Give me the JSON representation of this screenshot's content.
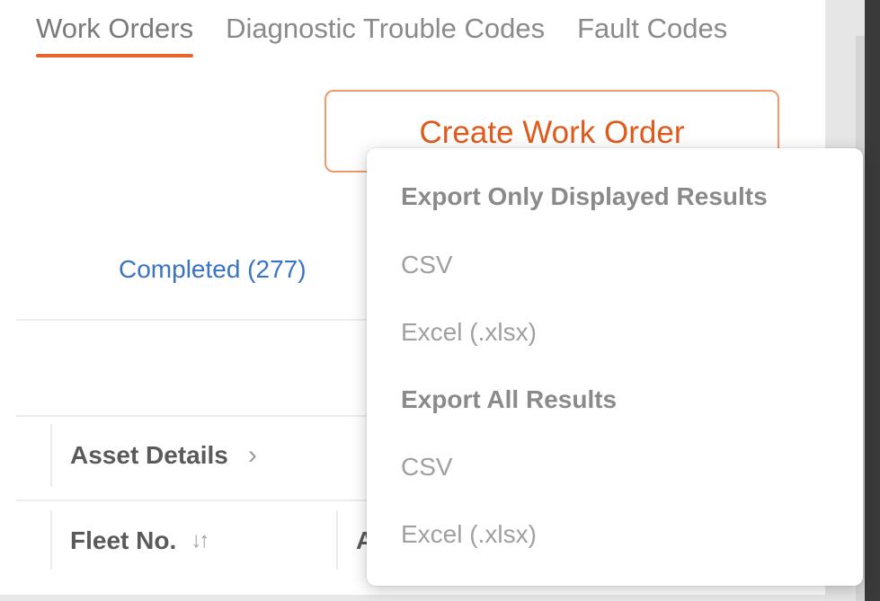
{
  "tabs": [
    {
      "label": "Work Orders",
      "active": true
    },
    {
      "label": "Diagnostic Trouble Codes",
      "active": false
    },
    {
      "label": "Fault Codes",
      "active": false
    }
  ],
  "create_button": {
    "label": "Create Work Order"
  },
  "status_filter": {
    "completed_label": "Completed (277)"
  },
  "table": {
    "group_header": {
      "label": "Asset Details",
      "icon": "chevron-right-icon"
    },
    "columns": [
      {
        "label": "Fleet No.",
        "sort_icon": "sort-arrows-icon"
      },
      {
        "label": "A"
      }
    ]
  },
  "export_menu": {
    "displayed_heading": "Export Only Displayed Results",
    "displayed_csv": "CSV",
    "displayed_excel": "Excel (.xlsx)",
    "all_heading": "Export All Results",
    "all_csv": "CSV",
    "all_excel": "Excel (.xlsx)"
  },
  "colors": {
    "accent": "#e8632b",
    "link": "#3a72c4"
  }
}
